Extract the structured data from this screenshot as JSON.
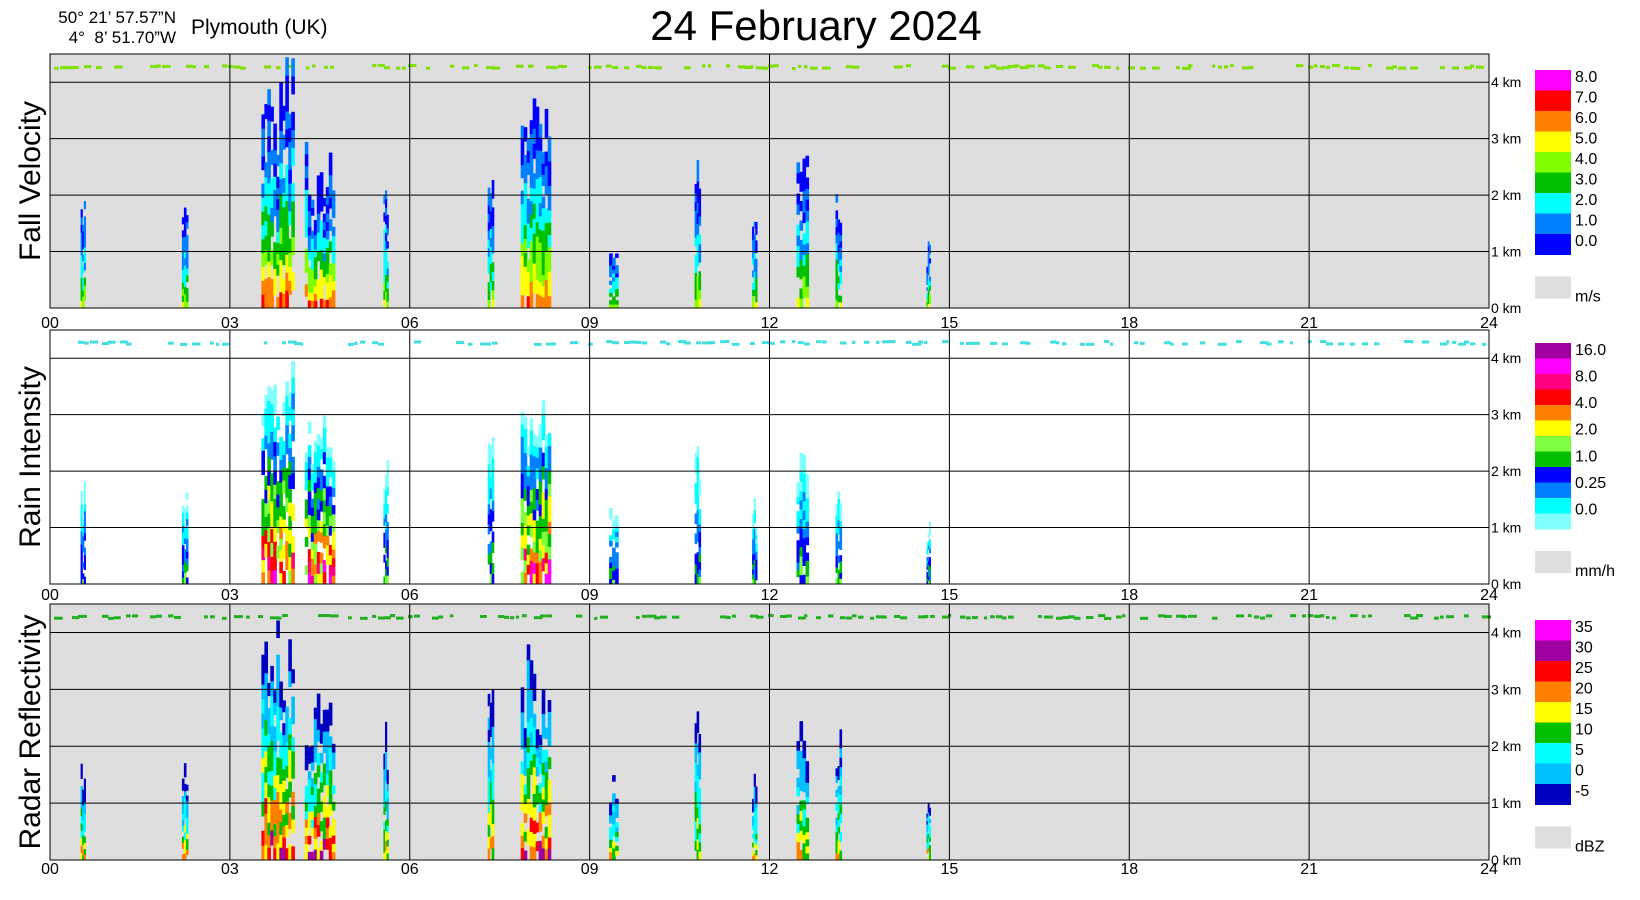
{
  "header": {
    "lat": "50° 21’ 57.57”N",
    "lon": "4°  8’ 51.70”W",
    "location": "Plymouth (UK)",
    "title": "24 February  2024"
  },
  "chart_data": [
    {
      "type": "heatmap",
      "ylabel": "Fall Velocity",
      "background": "#dedede",
      "x_ticks": [
        "00",
        "03",
        "06",
        "09",
        "12",
        "15",
        "18",
        "21",
        "24"
      ],
      "xlim": [
        0,
        24
      ],
      "y_ticks": [
        "0 km",
        "1 km",
        "2 km",
        "3 km",
        "4 km"
      ],
      "ylim_km": [
        0,
        4.5
      ],
      "colorbar": {
        "unit": "m/s",
        "labels": [
          "8.0",
          "7.0",
          "6.0",
          "5.0",
          "4.0",
          "3.0",
          "2.0",
          "1.0",
          "0.0"
        ],
        "colors": [
          "#ff00ff",
          "#ff0000",
          "#ff8000",
          "#ffff00",
          "#80ff00",
          "#00c000",
          "#00ffff",
          "#0080ff",
          "#0000ff"
        ]
      }
    },
    {
      "type": "heatmap",
      "ylabel": "Rain Intensity",
      "background": "#ffffff",
      "x_ticks": [
        "00",
        "03",
        "06",
        "09",
        "12",
        "15",
        "18",
        "21",
        "24"
      ],
      "xlim": [
        0,
        24
      ],
      "y_ticks": [
        "0 km",
        "1 km",
        "2 km",
        "3 km",
        "4 km"
      ],
      "ylim_km": [
        0,
        4.5
      ],
      "colorbar": {
        "unit": "mm/h",
        "labels": [
          "16.0",
          "8.0",
          "4.0",
          "2.0",
          "1.0",
          "0.25",
          "0.0"
        ],
        "colors": [
          "#a000a0",
          "#ff00ff",
          "#ff0080",
          "#ff0000",
          "#ff8000",
          "#ffff00",
          "#80ff40",
          "#00c000",
          "#0000ff",
          "#0080ff",
          "#00ffff",
          "#80ffff"
        ]
      }
    },
    {
      "type": "heatmap",
      "ylabel": "Radar Reflectivity",
      "background": "#dedede",
      "x_ticks": [
        "00",
        "03",
        "06",
        "09",
        "12",
        "15",
        "18",
        "21",
        "24"
      ],
      "xlim": [
        0,
        24
      ],
      "y_ticks": [
        "0 km",
        "1 km",
        "2 km",
        "3 km",
        "4 km"
      ],
      "ylim_km": [
        0,
        4.5
      ],
      "colorbar": {
        "unit": "dBZ",
        "labels": [
          "35",
          "30",
          "25",
          "20",
          "15",
          "10",
          "5",
          "0",
          "-5"
        ],
        "colors": [
          "#ff00ff",
          "#a000a0",
          "#ff0000",
          "#ff8000",
          "#ffff00",
          "#00c000",
          "#00ffff",
          "#00c0ff",
          "#0000c0"
        ]
      }
    }
  ],
  "precip_events": [
    {
      "t": 0.55,
      "top": 2.0,
      "w": 0.08
    },
    {
      "t": 2.25,
      "top": 1.9,
      "w": 0.1
    },
    {
      "t": 3.8,
      "top": 4.5,
      "w": 0.55
    },
    {
      "t": 4.5,
      "top": 3.0,
      "w": 0.5
    },
    {
      "t": 5.6,
      "top": 2.7,
      "w": 0.08
    },
    {
      "t": 7.35,
      "top": 3.0,
      "w": 0.1
    },
    {
      "t": 8.1,
      "top": 3.8,
      "w": 0.5
    },
    {
      "t": 9.4,
      "top": 1.5,
      "w": 0.15
    },
    {
      "t": 10.8,
      "top": 2.8,
      "w": 0.1
    },
    {
      "t": 11.75,
      "top": 1.6,
      "w": 0.08
    },
    {
      "t": 12.55,
      "top": 2.8,
      "w": 0.2
    },
    {
      "t": 13.15,
      "top": 2.3,
      "w": 0.1
    },
    {
      "t": 14.65,
      "top": 1.2,
      "w": 0.04
    }
  ]
}
